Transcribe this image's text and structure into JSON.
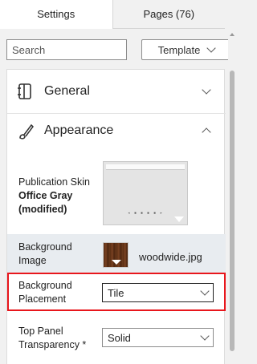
{
  "tabs": [
    {
      "label": "Settings",
      "active": true
    },
    {
      "label": "Pages (76)",
      "active": false
    }
  ],
  "search": {
    "placeholder": "Search"
  },
  "template_select": {
    "label": "Template"
  },
  "sections": {
    "general": {
      "title": "General",
      "icon": "book-icon",
      "expanded": false
    },
    "appearance": {
      "title": "Appearance",
      "icon": "brush-icon",
      "expanded": true
    }
  },
  "publication_skin": {
    "label": "Publication Skin",
    "value_line1": "Office Gray",
    "value_line2": "(modified)"
  },
  "background_image": {
    "label_line1": "Background",
    "label_line2": "Image",
    "filename": "woodwide.jpg"
  },
  "background_placement": {
    "label_line1": "Background",
    "label_line2": "Placement",
    "value": "Tile"
  },
  "top_panel_transparency": {
    "label_line1": "Top Panel",
    "label_line2": "Transparency *",
    "value": "Solid"
  },
  "colors": {
    "highlight": "#e8161c",
    "row_bg": "#e8ecf0",
    "tab_active_bg": "#ffffff"
  }
}
